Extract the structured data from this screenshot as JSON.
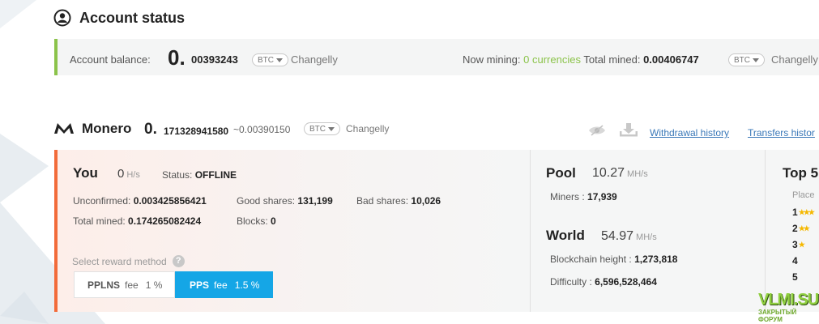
{
  "account": {
    "title": "Account status",
    "balance_label": "Account balance:",
    "balance_int": "0.",
    "balance_frac": "00393243",
    "currency": "BTC",
    "exchange": "Changelly",
    "now_mining_label": "Now mining:",
    "now_mining_value": "0 currencies",
    "total_mined_label": "Total mined:",
    "total_mined_value": "0.00406747",
    "currency2": "BTC",
    "exchange2": "Changelly"
  },
  "monero": {
    "title": "Monero",
    "balance_int": "0.",
    "balance_frac": "171328941580",
    "approx": "~0.00390150",
    "currency": "BTC",
    "exchange": "Changelly",
    "withdrawal_history": "Withdrawal history",
    "transfers_history": "Transfers histor"
  },
  "you": {
    "title": "You",
    "speed": "0",
    "speed_unit": "H/s",
    "status_label": "Status:",
    "status_value": "OFFLINE",
    "unconfirmed_label": "Unconfirmed:",
    "unconfirmed_value": "0.003425856421",
    "good_shares_label": "Good shares:",
    "good_shares_value": "131,199",
    "bad_shares_label": "Bad shares:",
    "bad_shares_value": "10,026",
    "total_mined_label": "Total mined:",
    "total_mined_value": "0.174265082424",
    "blocks_label": "Blocks:",
    "blocks_value": "0",
    "reward_method_label": "Select reward method",
    "help": "?",
    "pplns_label": "PPLNS",
    "pplns_fee_label": "fee",
    "pplns_fee": "1 %",
    "pps_label": "PPS",
    "pps_fee_label": "fee",
    "pps_fee": "1.5 %",
    "selected_method": "PPS"
  },
  "pool": {
    "title": "Pool",
    "speed": "10.27",
    "speed_unit": "MH/s",
    "miners_label": "Miners :",
    "miners_value": "17,939"
  },
  "world": {
    "title": "World",
    "speed": "54.97",
    "speed_unit": "MH/s",
    "height_label": "Blockchain height :",
    "height_value": "1,273,818",
    "difficulty_label": "Difficulty :",
    "difficulty_value": "6,596,528,464"
  },
  "top5": {
    "title": "Top 5",
    "place_header": "Place",
    "ranks": [
      "1",
      "2",
      "3",
      "4",
      "5"
    ]
  },
  "watermark": {
    "line1": "VLMI.SU",
    "line2": "ЗАКРЫТЫЙ ФОРУМ"
  },
  "colors": {
    "accent_green": "#8bc34a",
    "accent_orange": "#f26b3a",
    "pps_blue": "#15a6e6",
    "link_blue": "#3a78b8"
  }
}
